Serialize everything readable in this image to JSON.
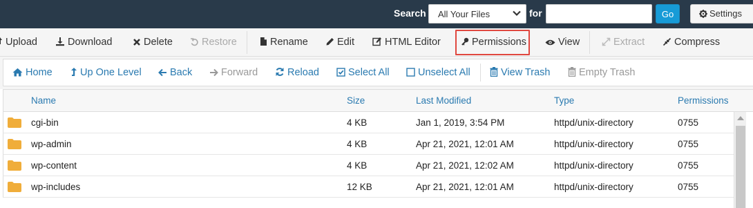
{
  "search": {
    "label": "Search",
    "scope_value": "All Your Files",
    "for_label": "for",
    "query": "",
    "go_label": "Go",
    "settings_label": "Settings"
  },
  "toolbar": {
    "upload": "Upload",
    "download": "Download",
    "delete": "Delete",
    "restore": "Restore",
    "rename": "Rename",
    "edit": "Edit",
    "html_editor": "HTML Editor",
    "permissions": "Permissions",
    "view": "View",
    "extract": "Extract",
    "compress": "Compress"
  },
  "nav": {
    "home": "Home",
    "up_one_level": "Up One Level",
    "back": "Back",
    "forward": "Forward",
    "reload": "Reload",
    "select_all": "Select All",
    "unselect_all": "Unselect All",
    "view_trash": "View Trash",
    "empty_trash": "Empty Trash"
  },
  "table": {
    "columns": {
      "name": "Name",
      "size": "Size",
      "modified": "Last Modified",
      "type": "Type",
      "permissions": "Permissions"
    },
    "rows": [
      {
        "name": "cgi-bin",
        "size": "4 KB",
        "modified": "Jan 1, 2019, 3:54 PM",
        "type": "httpd/unix-directory",
        "perms": "0755"
      },
      {
        "name": "wp-admin",
        "size": "4 KB",
        "modified": "Apr 21, 2021, 12:01 AM",
        "type": "httpd/unix-directory",
        "perms": "0755"
      },
      {
        "name": "wp-content",
        "size": "4 KB",
        "modified": "Apr 21, 2021, 12:02 AM",
        "type": "httpd/unix-directory",
        "perms": "0755"
      },
      {
        "name": "wp-includes",
        "size": "12 KB",
        "modified": "Apr 21, 2021, 12:01 AM",
        "type": "httpd/unix-directory",
        "perms": "0755"
      }
    ]
  },
  "colors": {
    "topbar_bg": "#293a4a",
    "go_button": "#179bd7",
    "link_blue": "#2a7ab0",
    "highlight_red": "#e0473f",
    "folder_yellow": "#f0ad3a"
  }
}
